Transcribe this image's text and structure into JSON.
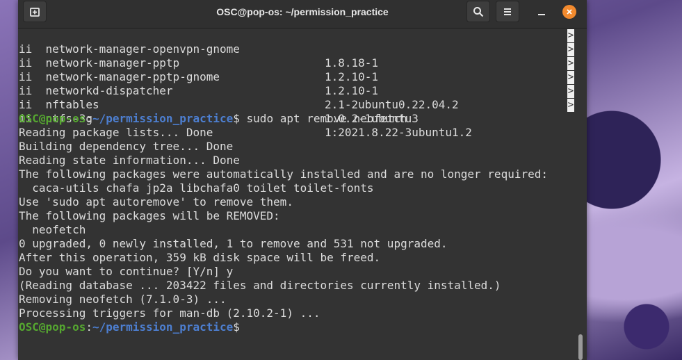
{
  "window": {
    "title": "OSC@pop-os: ~/permission_practice"
  },
  "icons": {
    "new_tab": "new-tab-icon",
    "search": "search-icon",
    "menu": "hamburger-menu-icon",
    "minimize": "minimize-icon",
    "close": "close-icon"
  },
  "colors": {
    "prompt_user": "#55a630",
    "prompt_path": "#4d7fd1",
    "close_button": "#f28a2e",
    "terminal_bg": "#333333"
  },
  "packages": [
    {
      "status": "ii",
      "name": "network-manager-openvpn-gnome",
      "version": "1.8.18-1",
      "more": ">"
    },
    {
      "status": "ii",
      "name": "network-manager-pptp",
      "version": "1.2.10-1",
      "more": ">"
    },
    {
      "status": "ii",
      "name": "network-manager-pptp-gnome",
      "version": "1.2.10-1",
      "more": ">"
    },
    {
      "status": "ii",
      "name": "networkd-dispatcher",
      "version": "2.1-2ubuntu0.22.04.2",
      "more": ">"
    },
    {
      "status": "ii",
      "name": "nftables",
      "version": "1.0.2-1ubuntu3",
      "more": ">"
    },
    {
      "status": "ii",
      "name": "ntfs-3g",
      "version": "1:2021.8.22-3ubuntu1.2",
      "more": ">"
    }
  ],
  "prompt": {
    "user": "OSC@pop-os",
    "sep": ":",
    "path": "~/permission_practice",
    "symbol": "$"
  },
  "command": " sudo apt remove neofetch",
  "output": [
    "Reading package lists... Done",
    "Building dependency tree... Done",
    "Reading state information... Done",
    "The following packages were automatically installed and are no longer required:",
    "  caca-utils chafa jp2a libchafa0 toilet toilet-fonts",
    "Use 'sudo apt autoremove' to remove them.",
    "The following packages will be REMOVED:",
    "  neofetch",
    "0 upgraded, 0 newly installed, 1 to remove and 531 not upgraded.",
    "After this operation, 359 kB disk space will be freed.",
    "Do you want to continue? [Y/n] y",
    "(Reading database ... 203422 files and directories currently installed.)",
    "Removing neofetch (7.1.0-3) ...",
    "Processing triggers for man-db (2.10.2-1) ..."
  ]
}
